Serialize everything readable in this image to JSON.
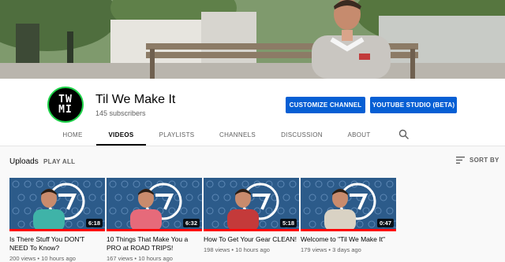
{
  "channel": {
    "avatar_text_top": "TW",
    "avatar_text_bottom": "MI",
    "name": "Til We Make It",
    "subscribers": "145 subscribers"
  },
  "buttons": {
    "customize": "CUSTOMIZE CHANNEL",
    "studio": "YOUTUBE STUDIO (BETA)"
  },
  "tabs": [
    {
      "label": "HOME",
      "active": false
    },
    {
      "label": "VIDEOS",
      "active": true
    },
    {
      "label": "PLAYLISTS",
      "active": false
    },
    {
      "label": "CHANNELS",
      "active": false
    },
    {
      "label": "DISCUSSION",
      "active": false
    },
    {
      "label": "ABOUT",
      "active": false
    }
  ],
  "uploads": {
    "heading": "Uploads",
    "play_all": "PLAY ALL",
    "sort_by": "SORT BY"
  },
  "videos": [
    {
      "title": "Is There Stuff You DON'T NEED To Know?",
      "duration": "6:18",
      "views": "200 views",
      "age": "10 hours ago",
      "meta": "200 views • 10 hours ago",
      "watched": true,
      "shirt": "#3fb3a8"
    },
    {
      "title": "10 Things That Make You a PRO at ROAD TRIPS!",
      "duration": "6:32",
      "views": "167 views",
      "age": "10 hours ago",
      "meta": "167 views • 10 hours ago",
      "watched": true,
      "shirt": "#e66a7a"
    },
    {
      "title": "How To Get Your Gear CLEAN!",
      "duration": "5:18",
      "views": "198 views",
      "age": "10 hours ago",
      "meta": "198 views • 10 hours ago",
      "watched": true,
      "shirt": "#c43a3a"
    },
    {
      "title": "Welcome to \"Til We Make It\"",
      "duration": "0:47",
      "views": "179 views",
      "age": "3 days ago",
      "meta": "179 views • 3 days ago",
      "watched": true,
      "shirt": "#d9d2c4"
    }
  ],
  "colors": {
    "accent_blue": "#065fd4",
    "progress_red": "#ff0000",
    "avatar_ring": "#1fd34a"
  }
}
